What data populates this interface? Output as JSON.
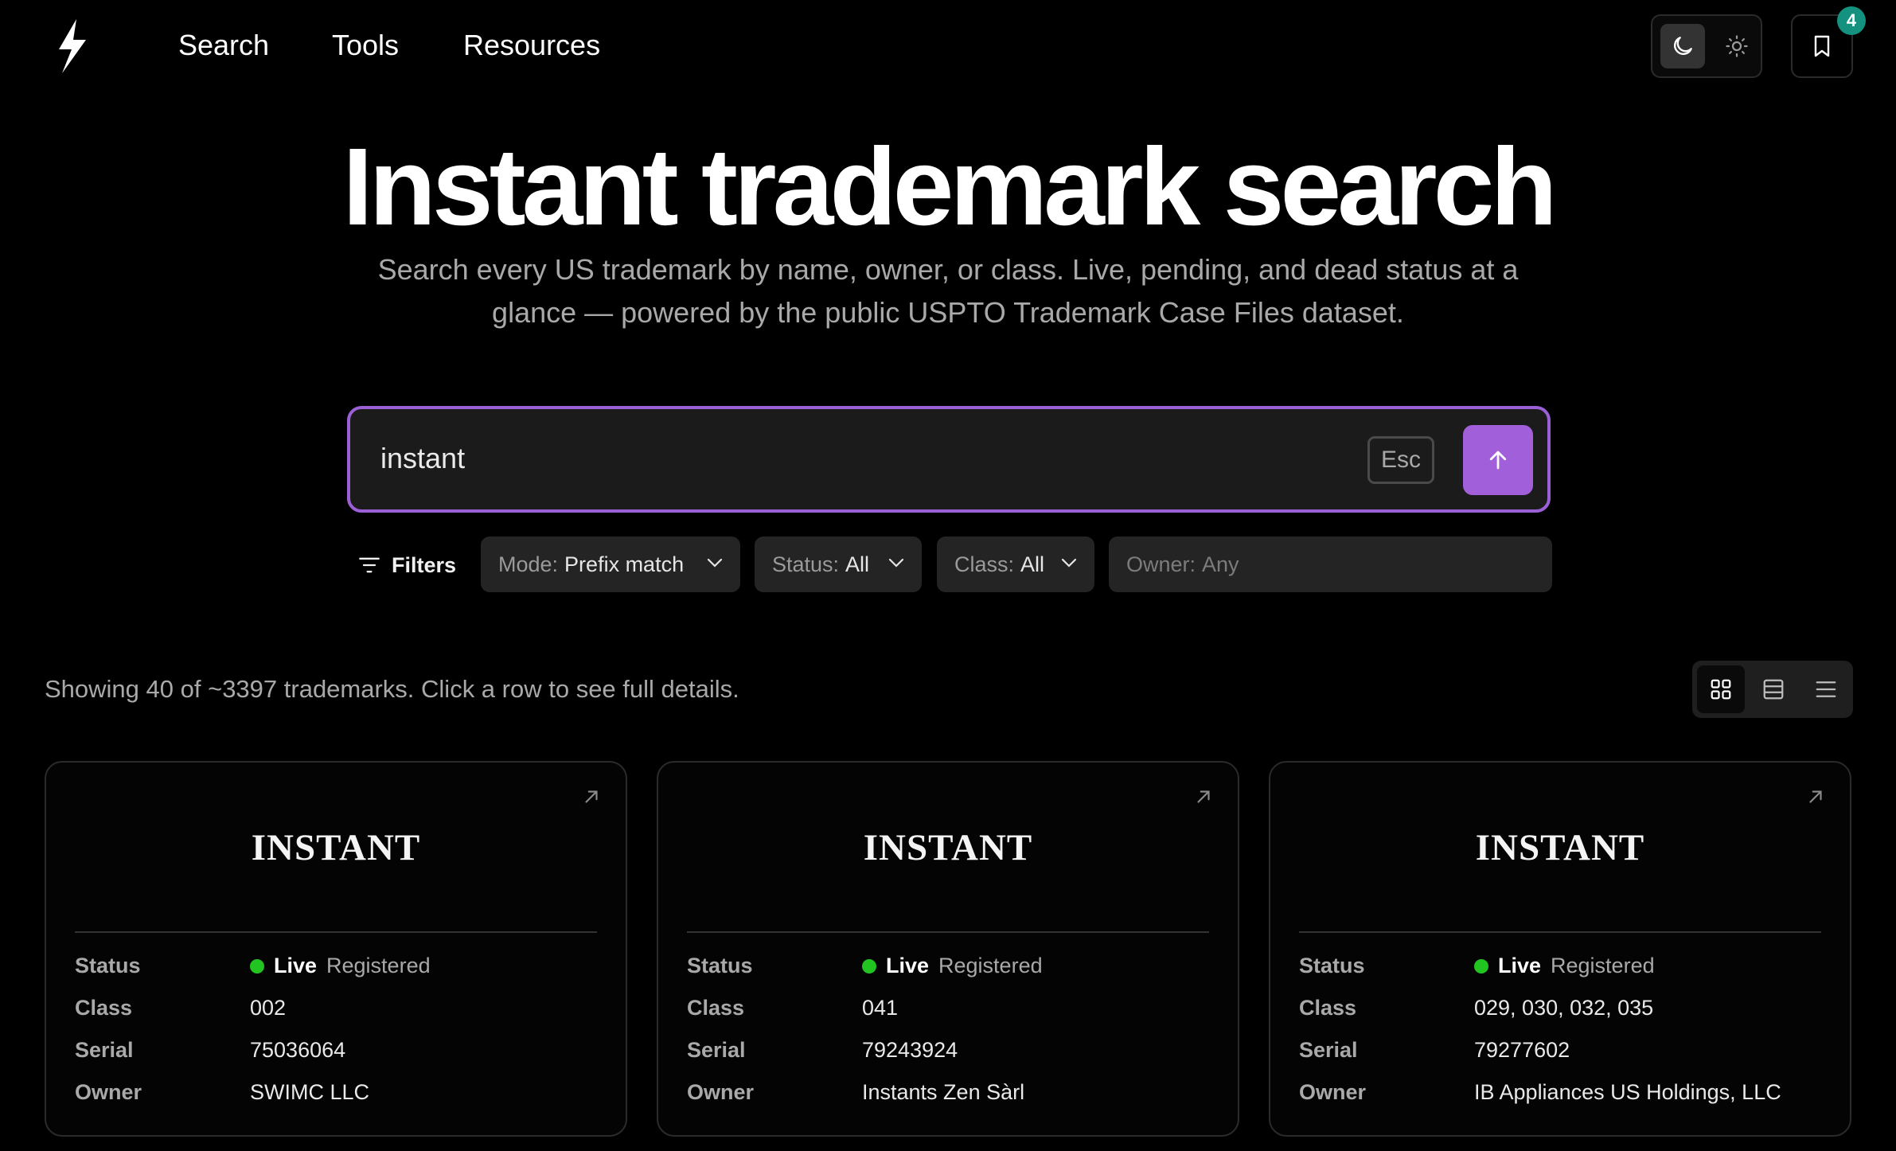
{
  "nav": {
    "search": "Search",
    "tools": "Tools",
    "resources": "Resources",
    "bookmark_count": "4"
  },
  "hero": {
    "title": "Instant trademark search",
    "subtitle": "Search every US trademark by name, owner, or class. Live, pending, and dead status at a glance — powered by the public USPTO Trademark Case Files dataset."
  },
  "search": {
    "value": "instant",
    "esc": "Esc"
  },
  "filters": {
    "label": "Filters",
    "mode": {
      "key": "Mode:",
      "value": "Prefix match"
    },
    "status": {
      "key": "Status:",
      "value": "All"
    },
    "class": {
      "key": "Class:",
      "value": "All"
    },
    "owner": {
      "key": "Owner:",
      "value": "Any"
    }
  },
  "results": {
    "summary": "Showing 40 of ~3397 trademarks. Click a row to see full details."
  },
  "labels": {
    "status": "Status",
    "class": "Class",
    "serial": "Serial",
    "owner": "Owner"
  },
  "cards": [
    {
      "name": "INSTANT",
      "status": "Live",
      "status_detail": "Registered",
      "class": "002",
      "serial": "75036064",
      "owner": "SWIMC LLC"
    },
    {
      "name": "INSTANT",
      "status": "Live",
      "status_detail": "Registered",
      "class": "041",
      "serial": "79243924",
      "owner": "Instants Zen Sàrl"
    },
    {
      "name": "INSTANT",
      "status": "Live",
      "status_detail": "Registered",
      "class": "029, 030, 032, 035",
      "serial": "79277602",
      "owner": "IB Appliances US Holdings, LLC"
    }
  ],
  "colors": {
    "accent": "#a15fd9",
    "live": "#21c421",
    "badge": "#14927f"
  }
}
